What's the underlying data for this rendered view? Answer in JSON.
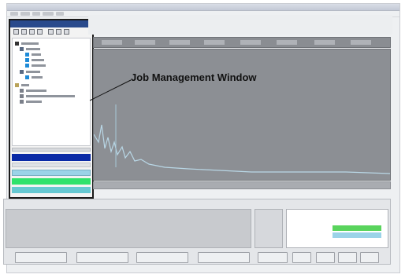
{
  "callout": {
    "label": "Job Management Window"
  },
  "colors": {
    "job_window_title": "#294a8c",
    "selected_row": "#0a2aa6",
    "status_green": "#2fe26b",
    "status_blue": "#9bd3e8",
    "plot_background": "#8c8f94",
    "trace": "#b9d7e6"
  },
  "icons": [
    "app-icon",
    "open-icon",
    "save-icon",
    "folder-icon",
    "settings-icon",
    "close-icon"
  ]
}
